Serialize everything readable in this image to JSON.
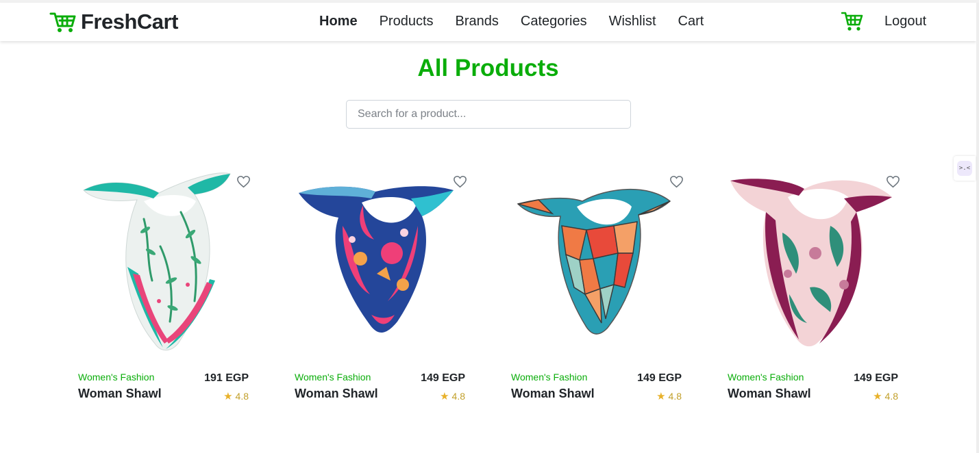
{
  "brand": {
    "name": "FreshCart",
    "icon": "cart-icon",
    "accent": "#0aad0a"
  },
  "nav": {
    "links": [
      {
        "label": "Home",
        "active": true
      },
      {
        "label": "Products",
        "active": false
      },
      {
        "label": "Brands",
        "active": false
      },
      {
        "label": "Categories",
        "active": false
      },
      {
        "label": "Wishlist",
        "active": false
      },
      {
        "label": "Cart",
        "active": false
      }
    ],
    "cart_icon": "shopping-cart-icon",
    "logout_label": "Logout"
  },
  "page": {
    "title": "All Products",
    "title_color": "#0aad0a"
  },
  "search": {
    "placeholder": "Search for a product...",
    "value": ""
  },
  "products": [
    {
      "category": "Women's Fashion",
      "title": "Woman Shawl",
      "price": "191 EGP",
      "rating": "4.8",
      "palette": [
        "#e9eeec",
        "#1fb8a6",
        "#e9457a",
        "#2f9a6a"
      ]
    },
    {
      "category": "Women's Fashion",
      "title": "Woman Shawl",
      "price": "149 EGP",
      "rating": "4.8",
      "palette": [
        "#24469a",
        "#ef3f78",
        "#f4a24a",
        "#5fb0d8"
      ]
    },
    {
      "category": "Women's Fashion",
      "title": "Woman Shawl",
      "price": "149 EGP",
      "rating": "4.8",
      "palette": [
        "#2a9fb4",
        "#f07a45",
        "#e84a3a",
        "#9ed1c6"
      ]
    },
    {
      "category": "Women's Fashion",
      "title": "Woman Shawl",
      "price": "149 EGP",
      "rating": "4.8",
      "palette": [
        "#f3d3d6",
        "#8a1d52",
        "#2f8f7a",
        "#c77b9a"
      ]
    }
  ],
  "icons": {
    "wishlist": "heart-outline-icon",
    "rating": "star-icon",
    "extension": "extension-icon"
  }
}
